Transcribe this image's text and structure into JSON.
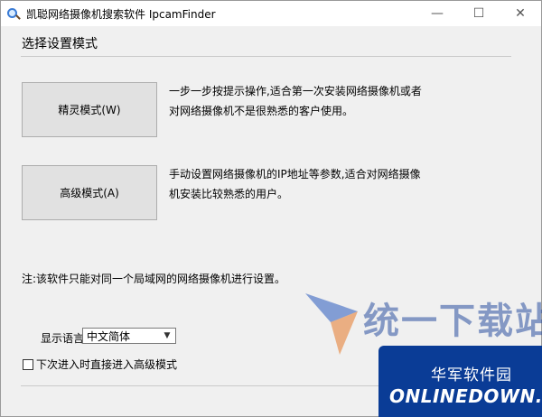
{
  "window": {
    "title": "凯聪网络摄像机搜索软件 IpcamFinder",
    "controls": {
      "minimize": "—",
      "maximize": "☐",
      "close": "✕"
    }
  },
  "main": {
    "section_title": "选择设置模式",
    "wizard": {
      "button_label": "精灵模式(W)",
      "description": "一步一步按提示操作,适合第一次安装网络摄像机或者对网络摄像机不是很熟悉的客户使用。"
    },
    "advanced": {
      "button_label": "高级模式(A)",
      "description": "手动设置网络摄像机的IP地址等参数,适合对网络摄像机安装比较熟悉的用户。"
    },
    "note": "注:该软件只能对同一个局域网的网络摄像机进行设置。",
    "language": {
      "label": "显示语言",
      "selected": "中文简体"
    },
    "startup_checkbox": {
      "label": "下次进入时直接进入高级模式",
      "checked": false
    }
  },
  "watermarks": {
    "site1": "统一下载站",
    "site2_cn": "华军软件园",
    "site2_en": "ONLINEDOWN.net"
  }
}
